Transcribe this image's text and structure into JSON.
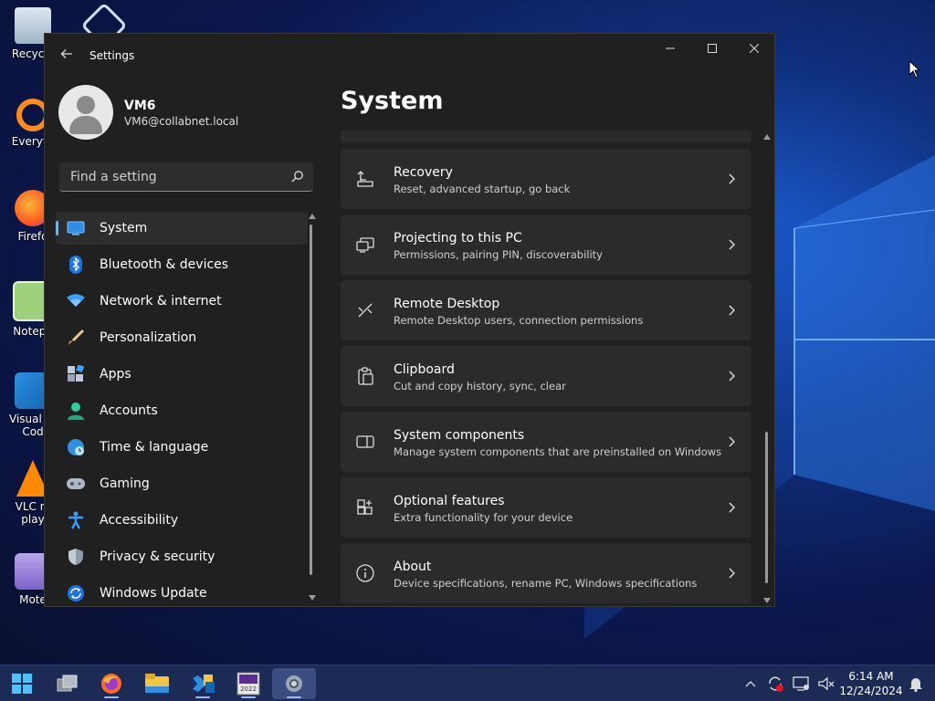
{
  "desktop": {
    "icons": [
      {
        "label": "Recycle"
      },
      {
        "label": "Everyth"
      },
      {
        "label": "Firefo"
      },
      {
        "label": "Notepa"
      },
      {
        "label": "Visual St Cod"
      },
      {
        "label": "VLC m play"
      },
      {
        "label": "Mote"
      }
    ]
  },
  "window": {
    "title": "Settings",
    "profile": {
      "name": "VM6",
      "email": "VM6@collabnet.local"
    },
    "search": {
      "placeholder": "Find a setting"
    },
    "nav": [
      {
        "label": "System",
        "icon": "monitor-icon",
        "active": true
      },
      {
        "label": "Bluetooth & devices",
        "icon": "bluetooth-icon"
      },
      {
        "label": "Network & internet",
        "icon": "wifi-icon"
      },
      {
        "label": "Personalization",
        "icon": "paintbrush-icon"
      },
      {
        "label": "Apps",
        "icon": "apps-icon"
      },
      {
        "label": "Accounts",
        "icon": "person-icon"
      },
      {
        "label": "Time & language",
        "icon": "globe-clock-icon"
      },
      {
        "label": "Gaming",
        "icon": "gamepad-icon"
      },
      {
        "label": "Accessibility",
        "icon": "accessibility-icon"
      },
      {
        "label": "Privacy & security",
        "icon": "shield-icon"
      },
      {
        "label": "Windows Update",
        "icon": "update-icon"
      }
    ],
    "page_title": "System",
    "cards": [
      {
        "title": "Recovery",
        "subtitle": "Reset, advanced startup, go back",
        "icon": "recovery-icon"
      },
      {
        "title": "Projecting to this PC",
        "subtitle": "Permissions, pairing PIN, discoverability",
        "icon": "projecting-icon"
      },
      {
        "title": "Remote Desktop",
        "subtitle": "Remote Desktop users, connection permissions",
        "icon": "remote-desktop-icon"
      },
      {
        "title": "Clipboard",
        "subtitle": "Cut and copy history, sync, clear",
        "icon": "clipboard-icon"
      },
      {
        "title": "System components",
        "subtitle": "Manage system components that are preinstalled on Windows",
        "icon": "system-components-icon"
      },
      {
        "title": "Optional features",
        "subtitle": "Extra functionality for your device",
        "icon": "optional-features-icon"
      },
      {
        "title": "About",
        "subtitle": "Device specifications, rename PC, Windows specifications",
        "icon": "info-icon"
      }
    ]
  },
  "taskbar": {
    "apps": [
      "start-icon",
      "task-view-icon",
      "firefox-icon",
      "file-explorer-icon",
      "visual-studio-installer-icon",
      "visual-studio-2022-icon",
      "settings-icon"
    ],
    "clock": {
      "time": "6:14 AM",
      "date": "12/24/2024"
    }
  },
  "colors": {
    "accent": "#4cc2ff",
    "window_bg": "#202020",
    "card_bg": "#2b2b2b"
  }
}
